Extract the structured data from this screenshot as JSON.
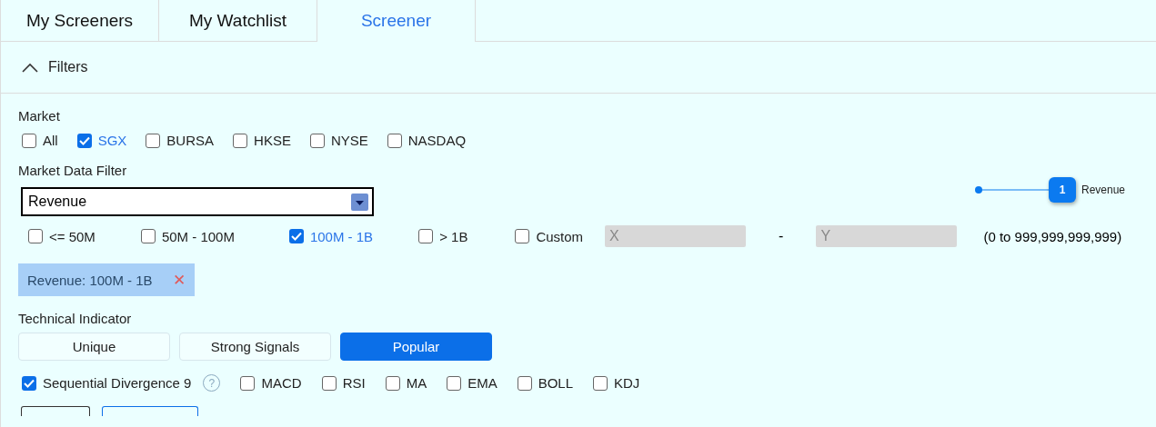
{
  "tabs": [
    {
      "label": "My Screeners",
      "selected": false
    },
    {
      "label": "My Watchlist",
      "selected": false
    },
    {
      "label": "Screener",
      "selected": true
    }
  ],
  "filters_header": {
    "label": "Filters",
    "expanded": true
  },
  "market": {
    "label": "Market",
    "options": [
      {
        "label": "All",
        "checked": false
      },
      {
        "label": "SGX",
        "checked": true
      },
      {
        "label": "BURSA",
        "checked": false
      },
      {
        "label": "HKSE",
        "checked": false
      },
      {
        "label": "NYSE",
        "checked": false
      },
      {
        "label": "NASDAQ",
        "checked": false
      }
    ]
  },
  "market_data_filter": {
    "label": "Market Data Filter",
    "select_value": "Revenue",
    "ranges": [
      {
        "label": "<= 50M",
        "checked": false
      },
      {
        "label": "50M - 100M",
        "checked": false
      },
      {
        "label": "100M - 1B",
        "checked": true
      },
      {
        "label": "> 1B",
        "checked": false
      }
    ],
    "custom": {
      "label": "Custom",
      "checked": false,
      "from_placeholder": "X",
      "separator": "-",
      "to_placeholder": "Y",
      "hint": "(0 to 999,999,999,999)"
    },
    "chips": [
      {
        "label": "Revenue: 100M - 1B",
        "remove": "✕"
      }
    ]
  },
  "callout": {
    "number": "1",
    "label": "Revenue"
  },
  "technical_indicator": {
    "label": "Technical Indicator",
    "groups": [
      {
        "label": "Unique",
        "selected": false
      },
      {
        "label": "Strong Signals",
        "selected": false
      },
      {
        "label": "Popular",
        "selected": true
      }
    ],
    "indicators": [
      {
        "label": "Sequential Divergence 9",
        "checked": true,
        "help": "?"
      },
      {
        "label": "MACD",
        "checked": false
      },
      {
        "label": "RSI",
        "checked": false
      },
      {
        "label": "MA",
        "checked": false
      },
      {
        "label": "EMA",
        "checked": false
      },
      {
        "label": "BOLL",
        "checked": false
      },
      {
        "label": "KDJ",
        "checked": false
      }
    ]
  }
}
